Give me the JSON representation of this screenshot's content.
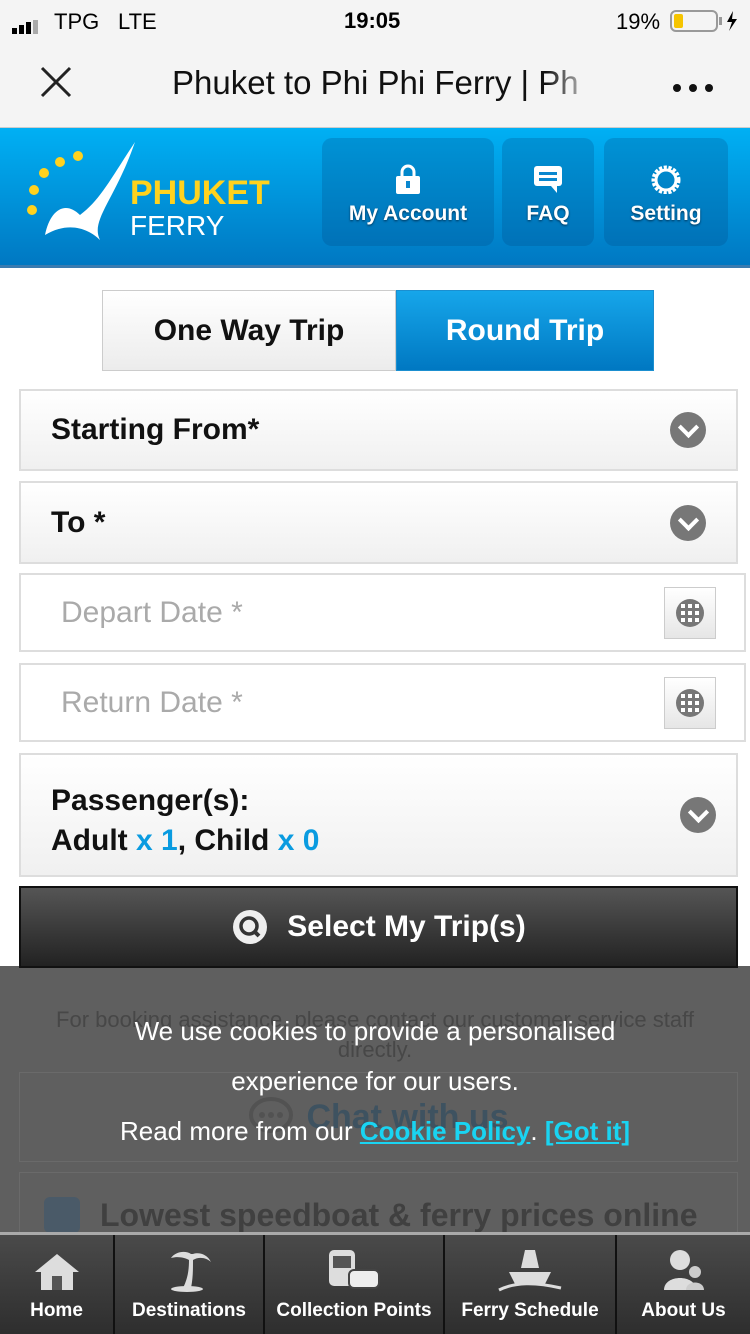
{
  "status_bar": {
    "carrier": "TPG",
    "network": "LTE",
    "time": "19:05",
    "battery": "19%",
    "battery_level": 0.19
  },
  "browser": {
    "title": "Phuket to Phi Phi Ferry | Ph",
    "close_icon": "close-icon",
    "menu_icon": "more-icon"
  },
  "header": {
    "logo_line1": "PHUKET",
    "logo_line2": "FERRY",
    "buttons": [
      {
        "label": "My Account",
        "icon": "lock-icon"
      },
      {
        "label": "FAQ",
        "icon": "chat-bubble-icon"
      },
      {
        "label": "Setting",
        "icon": "gear-icon"
      }
    ]
  },
  "trip_tabs": [
    {
      "label": "One Way Trip",
      "active": false
    },
    {
      "label": "Round Trip",
      "active": true
    }
  ],
  "form": {
    "starting_from": "Starting From*",
    "to": "To *",
    "depart_placeholder": "Depart Date *",
    "return_placeholder": "Return Date *",
    "passengers_label": "Passenger(s):",
    "adult_label": "Adult",
    "adult_count": "x 1",
    "child_label": ", Child",
    "child_count": "x 0",
    "submit": "Select My Trip(s)"
  },
  "below": {
    "assist": "For booking assistance, please contact our customer service staff directly.",
    "chat": "Chat with us",
    "lowest": "Lowest speedboat & ferry prices online"
  },
  "cookie": {
    "line1": "We use cookies to provide a personalised",
    "line2": "experience for our users.",
    "line3": "Read more from our ",
    "policy_link": "Cookie Policy",
    "sep": ".",
    "got_it": "[Got it]"
  },
  "bottom_nav": [
    {
      "label": "Home",
      "icon": "home-icon"
    },
    {
      "label": "Destinations",
      "icon": "palm-tree-icon"
    },
    {
      "label": "Collection Points",
      "icon": "bus-car-icon"
    },
    {
      "label": "Ferry Schedule",
      "icon": "ship-icon"
    },
    {
      "label": "About Us",
      "icon": "user-icon"
    }
  ],
  "colors": {
    "accent": "#0095dd",
    "link": "#19d4f2",
    "count": "#0a9be0"
  }
}
